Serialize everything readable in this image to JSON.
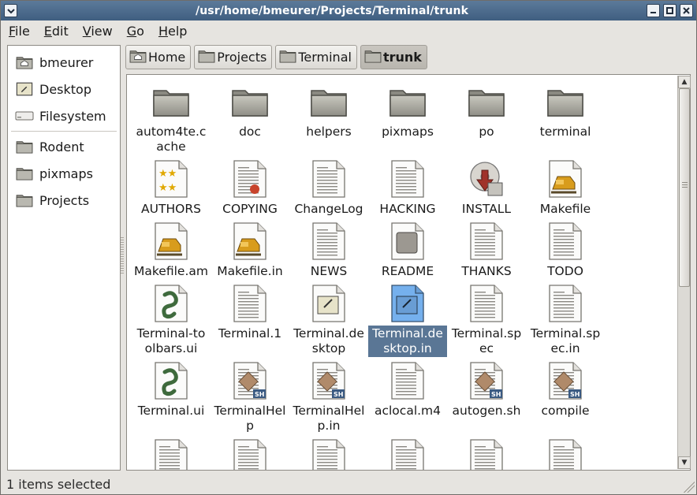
{
  "window": {
    "title": "/usr/home/bmeurer/Projects/Terminal/trunk"
  },
  "menubar": [
    {
      "label_u": "F",
      "label_rest": "ile"
    },
    {
      "label_u": "E",
      "label_rest": "dit"
    },
    {
      "label_u": "V",
      "label_rest": "iew"
    },
    {
      "label_u": "G",
      "label_rest": "o"
    },
    {
      "label_u": "H",
      "label_rest": "elp"
    }
  ],
  "sidebar": {
    "items": [
      {
        "label": "bmeurer",
        "icon": "home-folder-icon"
      },
      {
        "label": "Desktop",
        "icon": "desktop-icon"
      },
      {
        "label": "Filesystem",
        "icon": "harddisk-icon"
      },
      {
        "label": "Rodent",
        "icon": "folder-icon"
      },
      {
        "label": "pixmaps",
        "icon": "folder-icon"
      },
      {
        "label": "Projects",
        "icon": "folder-icon"
      }
    ]
  },
  "pathbar": [
    {
      "label": "Home",
      "icon": "home-folder-icon"
    },
    {
      "label": "Projects",
      "icon": "folder-icon"
    },
    {
      "label": "Terminal",
      "icon": "folder-icon"
    },
    {
      "label": "trunk",
      "icon": "folder-icon",
      "active": true
    }
  ],
  "files": [
    {
      "name": "autom4te.cache",
      "icon": "folder-icon"
    },
    {
      "name": "doc",
      "icon": "folder-icon"
    },
    {
      "name": "helpers",
      "icon": "folder-icon"
    },
    {
      "name": "pixmaps",
      "icon": "folder-icon"
    },
    {
      "name": "po",
      "icon": "folder-icon"
    },
    {
      "name": "terminal",
      "icon": "folder-icon"
    },
    {
      "name": "AUTHORS",
      "icon": "authors-icon"
    },
    {
      "name": "COPYING",
      "icon": "copying-icon"
    },
    {
      "name": "ChangeLog",
      "icon": "text-file-icon"
    },
    {
      "name": "HACKING",
      "icon": "text-file-icon"
    },
    {
      "name": "INSTALL",
      "icon": "install-icon"
    },
    {
      "name": "Makefile",
      "icon": "makefile-icon"
    },
    {
      "name": "Makefile.am",
      "icon": "makefile-icon"
    },
    {
      "name": "Makefile.in",
      "icon": "makefile-icon"
    },
    {
      "name": "NEWS",
      "icon": "text-file-icon"
    },
    {
      "name": "README",
      "icon": "readme-icon"
    },
    {
      "name": "THANKS",
      "icon": "text-file-icon"
    },
    {
      "name": "TODO",
      "icon": "text-file-icon"
    },
    {
      "name": "Terminal-toolbars.ui",
      "icon": "glade-icon"
    },
    {
      "name": "Terminal.1",
      "icon": "text-file-icon"
    },
    {
      "name": "Terminal.desktop",
      "icon": "desktop-file-icon"
    },
    {
      "name": "Terminal.desktop.in",
      "icon": "desktop-file-icon",
      "selected": true
    },
    {
      "name": "Terminal.spec",
      "icon": "text-file-icon"
    },
    {
      "name": "Terminal.spec.in",
      "icon": "text-file-icon"
    },
    {
      "name": "Terminal.ui",
      "icon": "glade-icon"
    },
    {
      "name": "TerminalHelp",
      "icon": "shell-script-icon"
    },
    {
      "name": "TerminalHelp.in",
      "icon": "shell-script-icon"
    },
    {
      "name": "aclocal.m4",
      "icon": "text-file-icon"
    },
    {
      "name": "autogen.sh",
      "icon": "shell-script-icon"
    },
    {
      "name": "compile",
      "icon": "shell-script-icon"
    },
    {
      "name": "",
      "icon": "text-file-icon"
    },
    {
      "name": "",
      "icon": "text-file-icon"
    },
    {
      "name": "",
      "icon": "text-file-icon"
    },
    {
      "name": "",
      "icon": "text-file-icon"
    },
    {
      "name": "",
      "icon": "text-file-icon"
    },
    {
      "name": "",
      "icon": "text-file-icon"
    }
  ],
  "status": {
    "text": "1 items selected"
  },
  "colors": {
    "titlebar": "#4a6a8c",
    "selection": "#5a7695",
    "background": "#e6e4e0"
  }
}
